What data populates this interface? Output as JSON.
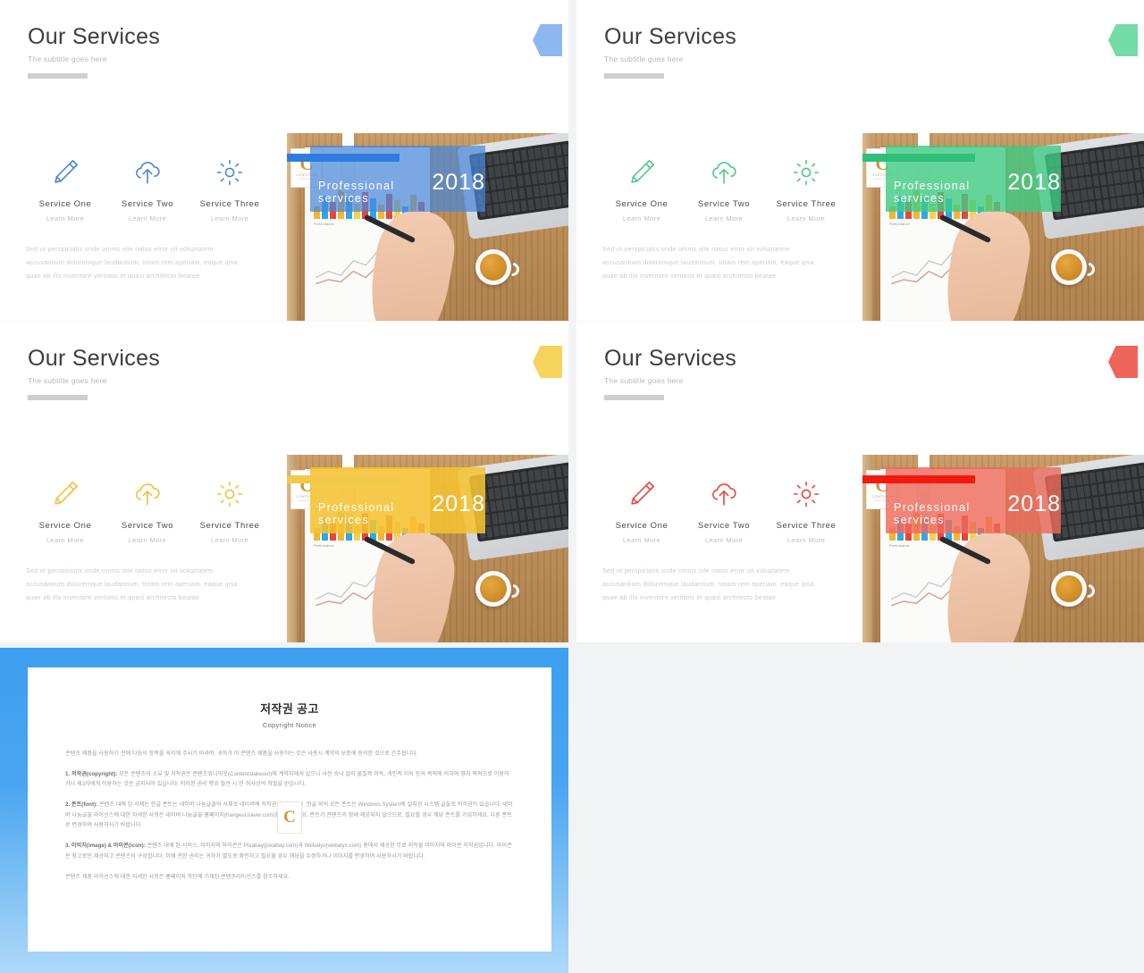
{
  "slides": [
    {
      "id": "blue",
      "title": "Our Services",
      "subtitle": "The subtitle goes here",
      "accent": "#4a86d8",
      "overlay": "rgba(74,134,216,0.72)",
      "bar": "#2f7ce0",
      "arrow": "#8db8ef",
      "services": [
        {
          "icon": "pencil-icon",
          "name": "Service One",
          "link": "Learn More"
        },
        {
          "icon": "cloud-upload-icon",
          "name": "Service Two",
          "link": "Learn More"
        },
        {
          "icon": "gear-icon",
          "name": "Service Three",
          "link": "Learn More"
        }
      ],
      "body": [
        "Sed ut perspiciatis  unde  omnis  iste  natus  error  sit  voluptatem",
        "accusantium  doloremque  laudantium,  totam  rem  aperiam,  eaque  ipsa",
        "quae  ab  illo  inventore  veritatis  et  quasi  architecto  beatae"
      ],
      "banner_text": "Professional  services",
      "banner_year": "2018"
    },
    {
      "id": "green",
      "title": "Our Services",
      "subtitle": "The subtitle goes here",
      "accent": "#4cc888",
      "overlay": "rgba(62,203,131,0.80)",
      "bar": "#2fbf77",
      "arrow": "#74dca7",
      "services": [
        {
          "icon": "pencil-icon",
          "name": "Service One",
          "link": "Learn More"
        },
        {
          "icon": "cloud-upload-icon",
          "name": "Service Two",
          "link": "Learn More"
        },
        {
          "icon": "gear-icon",
          "name": "Service Three",
          "link": "Learn More"
        }
      ],
      "body": [
        "Sed ut perspiciatis  unde  omnis  iste  natus  error  sit  voluptatem",
        "accusantium  doloremque  laudantium,  totam  rem  aperiam,  eaque  ipsa",
        "quae  ab  illo  inventore  veritatis  et  quasi  architecto  beatae"
      ],
      "banner_text": "Professional  services",
      "banner_year": "2018"
    },
    {
      "id": "yellow",
      "title": "Our Services",
      "subtitle": "The subtitle goes here",
      "accent": "#f2bf3d",
      "overlay": "rgba(245,193,49,0.88)",
      "bar": "#f0c84a",
      "arrow": "#f6d35c",
      "services": [
        {
          "icon": "pencil-icon",
          "name": "Service One",
          "link": "Learn More"
        },
        {
          "icon": "cloud-upload-icon",
          "name": "Service Two",
          "link": "Learn More"
        },
        {
          "icon": "gear-icon",
          "name": "Service Three",
          "link": "Learn More"
        }
      ],
      "body": [
        "Sed ut perspiciatis  unde  omnis  iste  natus  error  sit  voluptatem",
        "accusantium  doloremque  laudantium,  totam  rem  aperiam,  eaque  ipsa",
        "quae  ab  illo  inventore  veritatis  et  quasi  architecto  beatae"
      ],
      "banner_text": "Professional  services",
      "banner_year": "2018"
    },
    {
      "id": "red",
      "title": "Our Services",
      "subtitle": "The subtitle goes here",
      "accent": "#e8453c",
      "overlay": "rgba(237,106,92,0.82)",
      "bar": "#f21a0f",
      "arrow": "#f0655a",
      "services": [
        {
          "icon": "pencil-icon",
          "name": "Service One",
          "link": "Learn More"
        },
        {
          "icon": "cloud-upload-icon",
          "name": "Service Two",
          "link": "Learn More"
        },
        {
          "icon": "gear-icon",
          "name": "Service Three",
          "link": "Learn More"
        }
      ],
      "body": [
        "Sed ut perspiciatis  unde  omnis  iste  natus  error  sit  voluptatem",
        "accusantium  doloremque  laudantium,  totam  rem  aperiam,  eaque  ipsa",
        "quae  ab  illo  inventore  veritatis  et  quasi  architecto  beatae"
      ],
      "banner_text": "Professional  services",
      "banner_year": "2018"
    }
  ],
  "watermark": {
    "letter": "C",
    "line1": "CONTENTS",
    "line2": "PowerPoint"
  },
  "copyright": {
    "heading_ko": "저작권 공고",
    "heading_en": "Copyright Notice",
    "intro": "콘텐츠 제품을 사용하기 전에 다음의 항목을 숙지해 주시기 바라며, 귀하가 이 콘텐츠 제품을 사용하는 것은 사용시 계약의 보증에 동의한 것으로 간주됩니다.",
    "items": [
      {
        "label": "1. 저작권(copyright):",
        "text": " 모든 콘텐츠의 소유 및 저작권은 콘텐츠위니어웃(Contentstakeout)에 계약자에게 있으니 사전 승낙 없이 물질적 이득, 개인적 이득 등의 목적에 의하여 영리 목적으로 이용하거나 제3자에게 이용하는 것은 금지되어 있습니다. 이러한 권리 행위 발견 시 민·형사상의 처벌을 받습니다."
      },
      {
        "label": "2. 폰트(font):",
        "text": " 콘텐츠 내에 된 서체는 한글 폰트는 네이버 나눔글꼴의 서체로 네이버에 저작권이 있습니다. 한글 외의 모든 폰트는 Windows System에 설치된 시스템 글꼴로 저작권이 있습니다. 네이버 나눔글꼴 라이선스에 대한 자세한 사항은 네이버 나눔글꼴 홈페이지(hangeul.naver.com)를 참조하세요. 폰트가 콘텐츠의 함께 제공되지 않으므로, 필요할 경우 해당 폰트를 가입하세요. 다른 폰트로 변경하여 사용하시기 바랍니다."
      },
      {
        "label": "3. 이미지(image) & 아이콘(icon):",
        "text": " 콘텐츠 내에 된 서비스, 이미지와 아이콘은 Pixabay(pixabay.com)과 Webalys(webalys.com) 중에서 제공한 무료 저작물 이미지와 아이콘 저작권입니다. 아이콘은 참고로만 제공되고 콘텐츠의 구성합니다. 이에 관한 권리는 귀하가 별도로 확인하고 필요할 경우 해당을 수정하거나 이미지를 변경하여 사용하시기 바랍니다."
      }
    ],
    "footer": "콘텐츠 제품 라이선스에 대한 자세한 사항은 홈페이지 하단에 기재된 콘텐츠라이선스를 참조하세요."
  }
}
